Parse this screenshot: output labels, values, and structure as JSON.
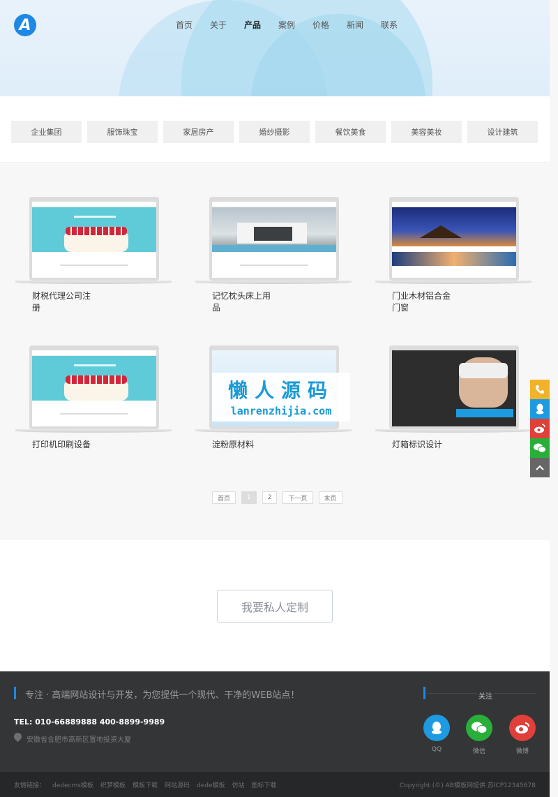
{
  "header": {
    "logo_letter": "A",
    "nav": [
      "首页",
      "关于",
      "产品",
      "案例",
      "价格",
      "新闻",
      "联系"
    ],
    "active_nav": "产品"
  },
  "categories": [
    "企业集团",
    "服饰珠宝",
    "家居房产",
    "婚纱摄影",
    "餐饮美食",
    "美容美妆",
    "设计建筑"
  ],
  "products": [
    {
      "title": "财税代理公司注册",
      "thumb": "cake"
    },
    {
      "title": "记忆枕头床上用品",
      "thumb": "house"
    },
    {
      "title": "门业木材铝合金门窗",
      "thumb": "resort"
    },
    {
      "title": "打印机印刷设备",
      "thumb": "cake"
    },
    {
      "title": "淀粉原材料",
      "thumb": "couple"
    },
    {
      "title": "灯箱标识设计",
      "thumb": "vr"
    }
  ],
  "watermark": {
    "line1": "懒人源码",
    "line2": "lanrenzhijia.com"
  },
  "pagination": {
    "first": "首页",
    "pages": [
      "1",
      "2"
    ],
    "current": "1",
    "next": "下一页",
    "last": "末页"
  },
  "custom": {
    "button_label": "我要私人定制"
  },
  "footer": {
    "slogan": "专注 · 高端网站设计与开发，为您提供一个现代、干净的WEB站点！",
    "tel": "TEL: 010-66889888 400-8899-9989",
    "address": "安徽省合肥市高新区置地投资大厦",
    "follow_label": "关注",
    "social": [
      {
        "label": "QQ",
        "icon": "qq-icon",
        "color": "#1e9be0"
      },
      {
        "label": "微信",
        "icon": "wechat-icon",
        "color": "#2aae3a"
      },
      {
        "label": "微博",
        "icon": "weibo-icon",
        "color": "#e0403a"
      }
    ],
    "links_label": "友情链接：",
    "links": [
      "dedecms模板",
      "织梦模板",
      "模板下载",
      "网站源码",
      "dede模板",
      "仿站",
      "图标下载"
    ],
    "copyright": "Copyright (©) AB模板网提供 苏ICP12345678"
  },
  "float_bar": [
    {
      "icon": "phone-icon",
      "color": "#f2b32b"
    },
    {
      "icon": "qq-icon",
      "color": "#1e9be0"
    },
    {
      "icon": "weibo-icon",
      "color": "#e0403a"
    },
    {
      "icon": "wechat-icon",
      "color": "#2aae3a"
    },
    {
      "icon": "back-to-top-icon",
      "color": "#666666"
    }
  ]
}
